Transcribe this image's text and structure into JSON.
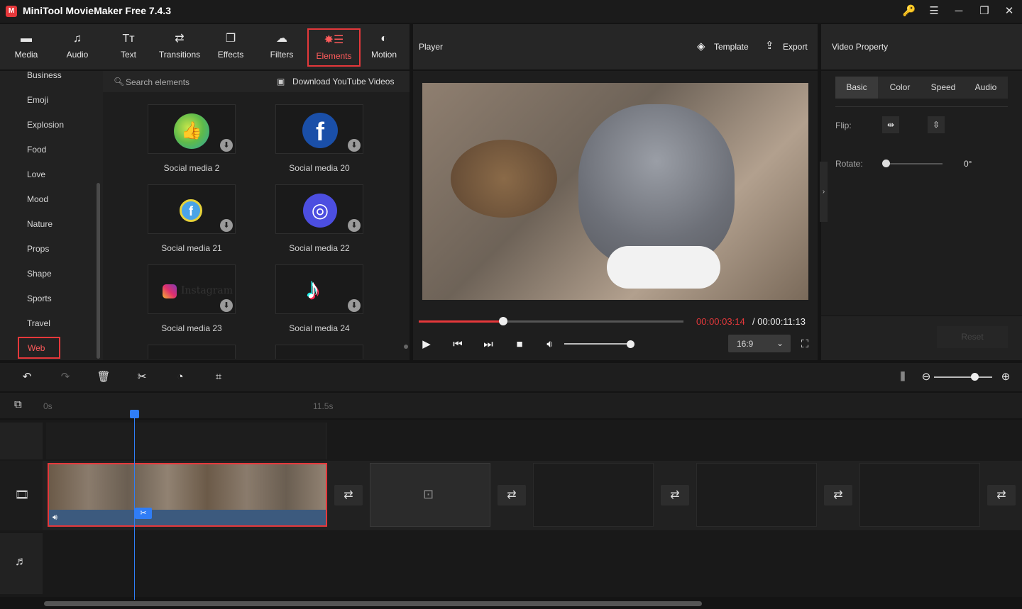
{
  "app": {
    "title": "MiniTool MovieMaker Free 7.4.3",
    "logo": "M"
  },
  "window_controls": {
    "key": "🔑",
    "menu": "☰",
    "minimize": "─",
    "maximize": "❐",
    "close": "✕"
  },
  "toolbar": [
    {
      "label": "Media",
      "icon": "▬"
    },
    {
      "label": "Audio",
      "icon": "♫"
    },
    {
      "label": "Text",
      "icon": "Tт"
    },
    {
      "label": "Transitions",
      "icon": "⇄"
    },
    {
      "label": "Effects",
      "icon": "❐"
    },
    {
      "label": "Filters",
      "icon": "☁"
    },
    {
      "label": "Elements",
      "icon": "✸☰"
    },
    {
      "label": "Motion",
      "icon": "◐"
    }
  ],
  "categories": [
    "Business",
    "Emoji",
    "Explosion",
    "Food",
    "Love",
    "Mood",
    "Nature",
    "Props",
    "Shape",
    "Sports",
    "Travel",
    "Web"
  ],
  "search": {
    "placeholder": "Search elements",
    "download_link": "Download YouTube Videos"
  },
  "elements": [
    {
      "label": "Social media 2",
      "icon": "👍"
    },
    {
      "label": "Social media 20",
      "icon": "f"
    },
    {
      "label": "Social media 21",
      "icon": "f"
    },
    {
      "label": "Social media 22",
      "icon": "◎"
    },
    {
      "label": "Social media 23",
      "icon": "Instagram"
    },
    {
      "label": "Social media 24",
      "icon": "♪"
    }
  ],
  "player": {
    "title": "Player",
    "template_label": "Template",
    "export_label": "Export",
    "current_time": "00:00:03:14",
    "total_time": "/ 00:00:11:13",
    "aspect": "16:9",
    "progress": 0.32,
    "volume": 0.8
  },
  "property": {
    "title": "Video Property",
    "tabs": [
      "Basic",
      "Color",
      "Speed",
      "Audio"
    ],
    "flip_label": "Flip:",
    "rotate_label": "Rotate:",
    "rotate_value": "0°",
    "reset_label": "Reset"
  },
  "timeline": {
    "ruler_start": "0s",
    "ruler_mark": "11.5s"
  },
  "colors": {
    "accent": "#e5383b",
    "playhead": "#2f7df6"
  }
}
